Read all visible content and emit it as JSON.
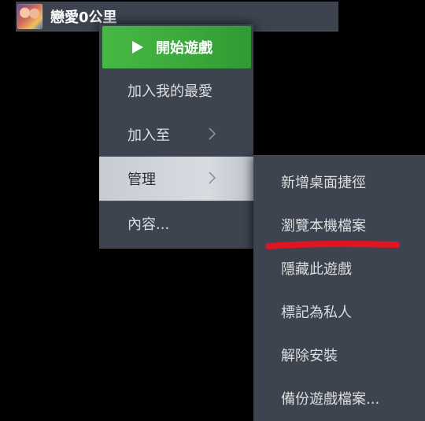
{
  "game": {
    "title": "戀愛0公里",
    "thumbnail_icon": "game-thumbnail"
  },
  "context_menu": {
    "play_label": "開始遊戲",
    "play_icon": "play-triangle-icon",
    "items": [
      {
        "label": "加入我的最愛"
      },
      {
        "label": "加入至"
      },
      {
        "label": "管理"
      },
      {
        "label": "內容..."
      }
    ]
  },
  "manage_submenu": {
    "items": [
      {
        "label": "新增桌面捷徑"
      },
      {
        "label": "瀏覽本機檔案"
      },
      {
        "label": "隱藏此遊戲"
      },
      {
        "label": "標記為私人"
      },
      {
        "label": "解除安裝"
      },
      {
        "label": "備份遊戲檔案..."
      }
    ]
  },
  "colors": {
    "background": "#000000",
    "menu_bg": "#3d4450",
    "play_green": "#47b844",
    "highlight": "#d8dce1",
    "annotation_red": "#e01524"
  }
}
